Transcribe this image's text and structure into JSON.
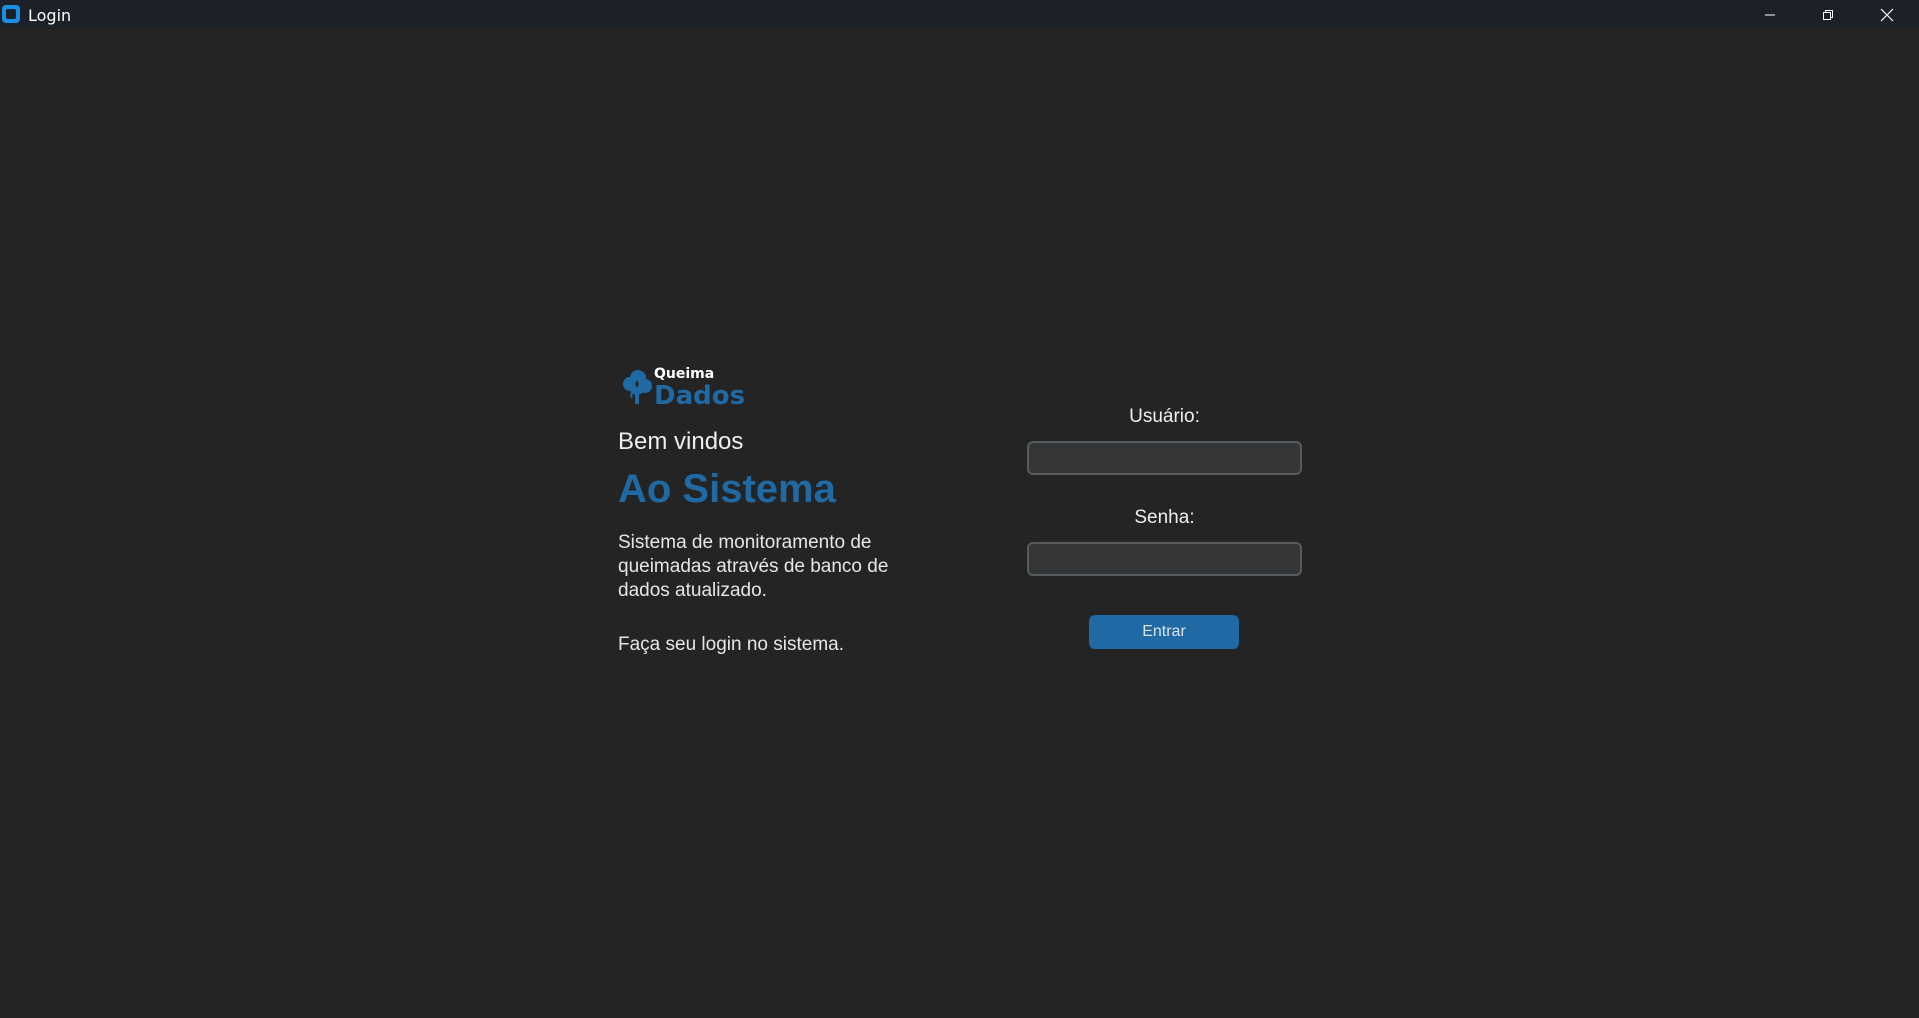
{
  "window": {
    "title": "Login",
    "controls": {
      "minimize": "minimize-icon",
      "maximize": "restore-icon",
      "close": "close-icon"
    }
  },
  "brand": {
    "logo_top": "Queima",
    "logo_bottom": "Dados",
    "logo_icon": "tree-fire-icon",
    "color": "#1f6aa5"
  },
  "intro": {
    "welcome": "Bem vindos",
    "headline": "Ao Sistema",
    "description": "Sistema de monitoramento de queimadas através de banco de dados atualizado.",
    "cta": "Faça seu login no sistema."
  },
  "form": {
    "username_label": "Usuário:",
    "username_value": "",
    "password_label": "Senha:",
    "password_value": "",
    "submit_label": "Entrar"
  },
  "colors": {
    "background": "#242424",
    "titlebar": "#1c2029",
    "accent": "#1f6aa5",
    "input_bg": "#343638",
    "input_border": "#565b5e"
  }
}
